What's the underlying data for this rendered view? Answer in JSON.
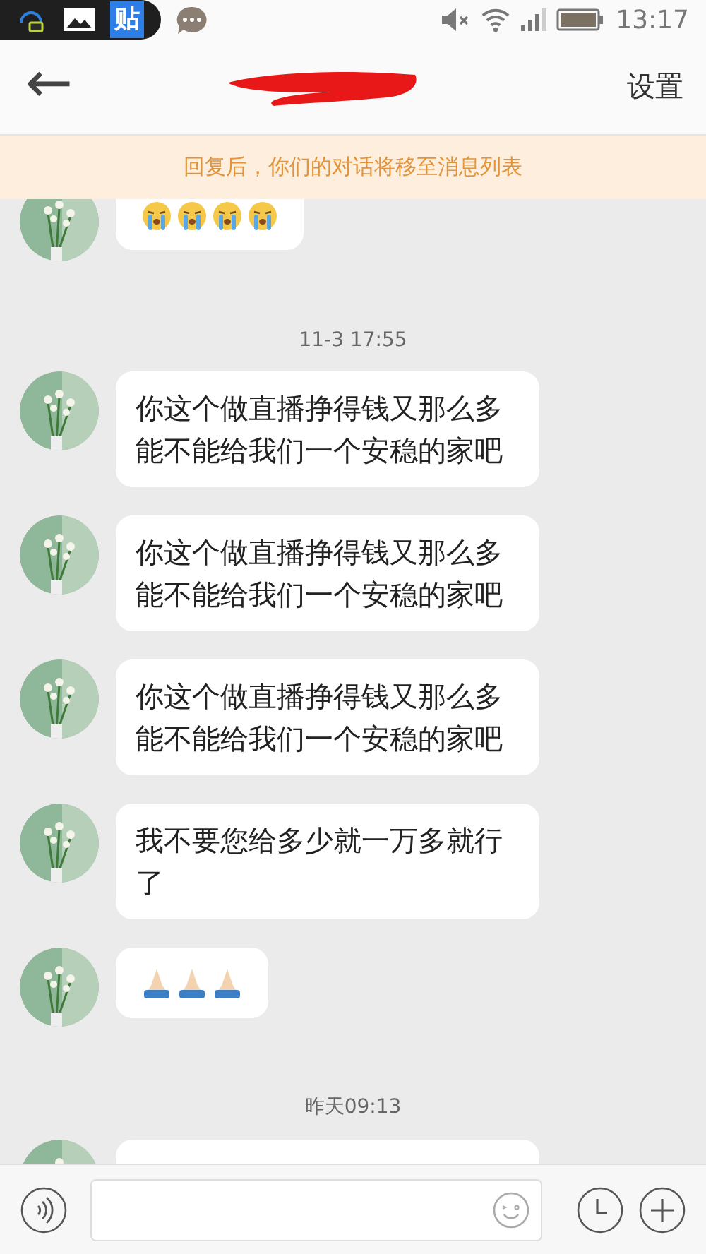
{
  "status_bar": {
    "app_badge": "贴",
    "time": "13:17"
  },
  "header": {
    "back_label": "←",
    "settings": "设置"
  },
  "notice": "回复后，你们的对话将移至消息列表",
  "messages": [
    {
      "kind": "emoji",
      "emojis": [
        {
          "kind": "crying"
        },
        {
          "kind": "crying"
        },
        {
          "kind": "crying"
        },
        {
          "kind": "crying"
        }
      ]
    },
    {
      "kind": "time",
      "text": "11-3 17:55"
    },
    {
      "kind": "text",
      "text": "你这个做直播挣得钱又那么多能不能给我们一个安稳的家吧"
    },
    {
      "kind": "text",
      "text": "你这个做直播挣得钱又那么多能不能给我们一个安稳的家吧"
    },
    {
      "kind": "text",
      "text": "你这个做直播挣得钱又那么多能不能给我们一个安稳的家吧"
    },
    {
      "kind": "text",
      "text": "我不要您给多少就一万多就行了"
    },
    {
      "kind": "emoji",
      "emojis": [
        {
          "kind": "praying"
        },
        {
          "kind": "praying"
        },
        {
          "kind": "praying"
        }
      ]
    },
    {
      "kind": "time",
      "text": "昨天09:13"
    },
    {
      "kind": "partial"
    }
  ]
}
